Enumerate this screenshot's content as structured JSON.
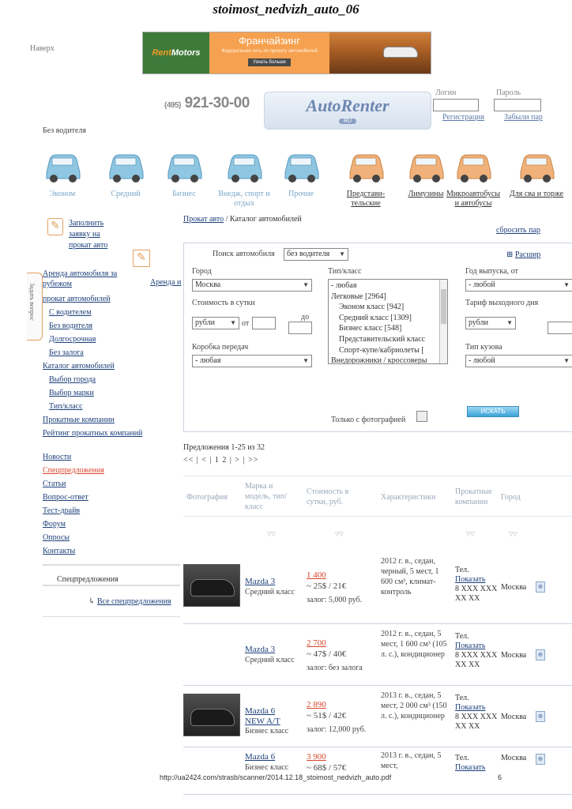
{
  "doc_title": "stoimost_nedvizh_auto_06",
  "naverh": "Наверх",
  "banner": {
    "logo_a": "Rent",
    "logo_b": "Motors",
    "heading": "Франчайзинг",
    "sub": "Федеральная сеть по прокату автомобилей",
    "btn": "Узнать больше"
  },
  "header": {
    "phone_code": "(495)",
    "phone": "921-30-00",
    "logo": "AutoRenter",
    "logo_ru": "RU",
    "login_label": "Логин",
    "password_label": "Пароль",
    "register": "Регистрация",
    "forgot": "Забыли пар"
  },
  "bez_voditelya": "Без водителя",
  "categories": [
    {
      "label": "Эконом",
      "tone": "blue"
    },
    {
      "label": "Средний",
      "tone": "blue"
    },
    {
      "label": "Бизнес",
      "tone": "blue"
    },
    {
      "label": "Внедж, спорт и отдых",
      "tone": "blue"
    },
    {
      "label": "Прочие",
      "tone": "blue"
    },
    {
      "label": "Представи-тельские",
      "tone": "orange"
    },
    {
      "label": "Лимузины",
      "tone": "orange"
    },
    {
      "label": "Микроавтобусы и автобусы",
      "tone": "orange"
    },
    {
      "label": "Для сва и торже",
      "tone": "orange"
    }
  ],
  "sidebar": {
    "request": "Заполнить заявку на прокат авто",
    "tab_vertical": "Задать вопрос",
    "arenda_right": "Аренда и",
    "menu1": [
      {
        "label": "Аренда автомобиля за рубежом",
        "indent": false
      },
      {
        "label": "прокат автомобилей",
        "indent": false
      },
      {
        "label": "С водителем",
        "indent": true
      },
      {
        "label": "Без водителя",
        "indent": true
      },
      {
        "label": "Долгосрочная",
        "indent": true
      },
      {
        "label": "Без залога",
        "indent": true
      },
      {
        "label": "Каталог автомобилей",
        "indent": false
      },
      {
        "label": "Выбор города",
        "indent": true
      },
      {
        "label": "Выбор марки",
        "indent": true
      },
      {
        "label": "Тип/класс",
        "indent": true
      },
      {
        "label": "Прокатные компании",
        "indent": false
      },
      {
        "label": "Рейтинг прокатных компаний",
        "indent": false
      }
    ],
    "menu2": [
      {
        "label": "Новости",
        "red": false
      },
      {
        "label": "Спецпредложения",
        "red": true
      },
      {
        "label": "Статьи",
        "red": false
      },
      {
        "label": "Вопрос-ответ",
        "red": false
      },
      {
        "label": "Тест-драйв",
        "red": false
      },
      {
        "label": "Форум",
        "red": false
      },
      {
        "label": "Опросы",
        "red": false
      },
      {
        "label": "Контакты",
        "red": false
      }
    ],
    "spec_title": "Спецпредложения",
    "spec_all": "Все спецпредложения"
  },
  "breadcrumb": {
    "link": "Прокат авто",
    "current": "/ Каталог автомобилей"
  },
  "reset": "сбросить пар",
  "search": {
    "title": "Поиск автомобиля",
    "mode": "без водителя",
    "extended": "Расшир",
    "city_label": "Город",
    "city_value": "Москва",
    "price_label": "Стоимость в сутки",
    "currency": "рубли",
    "from": "от",
    "to": "до",
    "gearbox_label": "Коробка передач",
    "gearbox_value": "- любая",
    "type_label": "Тип/класс",
    "type_options": [
      {
        "label": "- любая",
        "indent": false
      },
      {
        "label": "Легковые [2964]",
        "indent": false
      },
      {
        "label": "Эконом класс [942]",
        "indent": true
      },
      {
        "label": "Средний класс [1309]",
        "indent": true
      },
      {
        "label": "Бизнес класс [548]",
        "indent": true
      },
      {
        "label": "Представительский класс",
        "indent": true
      },
      {
        "label": "Спорт-купе/кабриолеты [",
        "indent": true
      },
      {
        "label": "Внедорожники / кроссоверы",
        "indent": false
      }
    ],
    "year_label": "Год выпуска, от",
    "year_value": "- любой",
    "tariff_label": "Тариф выходного дня",
    "tariff_currency": "рубли",
    "body_label": "Тип кузова",
    "body_value": "- любой",
    "photo_only": "Только с фотографией",
    "btn": "ИСКАТЬ"
  },
  "offers": "Предложения 1-25 из 32",
  "pager": "<< | < | 1 2 | > | >>",
  "table": {
    "headers": {
      "photo": "Фотография",
      "model": "Марка и модель, тип/класс",
      "price": "Стоимость в сутки, руб.",
      "chars": "Характеристики",
      "company": "Прокатные компании",
      "city": "Город"
    },
    "rows": [
      {
        "model": "Mazda 3",
        "class": "Средний класс",
        "price": "1 400",
        "price2": "~ 25$ / 21€",
        "zalog": "залог: 5,000 руб.",
        "chars": "2012 г. в., седан, черный, 5 мест, 1 600 см³, климат-контроль",
        "tel": "Тел.",
        "show": "Показать",
        "num": "8 XXX XXX XX XX",
        "city": "Москва",
        "photo": true
      },
      {
        "model": "Mazda 3",
        "class": "Средний класс",
        "price": "2 700",
        "price2": "~ 47$ / 40€",
        "zalog": "залог: без залога",
        "chars": "2012 г. в., седан, 5 мест, 1 600 см³ (105 л. с.), кондиционер",
        "tel": "Тел.",
        "show": "Показать",
        "num": "8 XXX XXX XX XX",
        "city": "Москва",
        "photo": false
      },
      {
        "model": "Mazda 6 NEW A/T",
        "class": "Бизнес класс",
        "price": "2 890",
        "price2": "~ 51$ / 42€",
        "zalog": "залог: 12,000 руб.",
        "chars": "2013 г. в., седан, 5 мест, 2 000 см³ (150 л. с.), кондиционер",
        "tel": "Тел.",
        "show": "Показать",
        "num": "8 XXX XXX XX XX",
        "city": "Москва",
        "photo": true
      },
      {
        "model": "Mazda 6",
        "class": "Бизнес класс",
        "price": "3 900",
        "price2": "~ 68$ / 57€",
        "zalog": "",
        "chars": "2013 г. в., седан, 5 мест,",
        "tel": "Тел.",
        "show": "Показать",
        "num": "",
        "city": "Москва",
        "photo": false
      }
    ]
  },
  "footer": "http://ua2424.com/strasb/scanner/2014.12.18_stoimost_nedvizh_auto.pdf",
  "page_number": "6"
}
